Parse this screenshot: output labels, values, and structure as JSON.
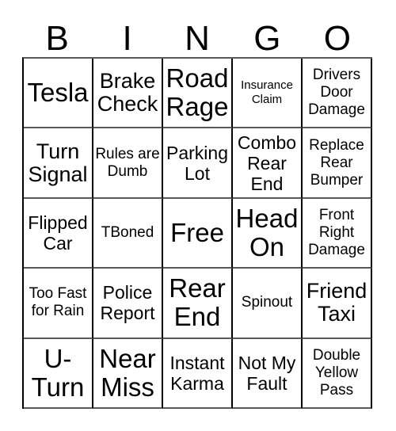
{
  "card": {
    "columns": [
      "B",
      "I",
      "N",
      "G",
      "O"
    ],
    "rows": [
      [
        {
          "text": "Tesla",
          "size": "fs-xl"
        },
        {
          "text": "Brake Check",
          "size": "fs-lg"
        },
        {
          "text": "Road Rage",
          "size": "fs-xl"
        },
        {
          "text": "Insurance Claim",
          "size": "fs-xs"
        },
        {
          "text": "Drivers Door Damage",
          "size": "fs-sm"
        }
      ],
      [
        {
          "text": "Turn Signal",
          "size": "fs-lg"
        },
        {
          "text": "Rules are Dumb",
          "size": "fs-sm"
        },
        {
          "text": "Parking Lot",
          "size": "fs-md"
        },
        {
          "text": "Combo Rear End",
          "size": "fs-md"
        },
        {
          "text": "Replace Rear Bumper",
          "size": "fs-sm"
        }
      ],
      [
        {
          "text": "Flipped Car",
          "size": "fs-md"
        },
        {
          "text": "TBoned",
          "size": "fs-sm"
        },
        {
          "text": "Free",
          "size": "fs-xl"
        },
        {
          "text": "Head On",
          "size": "fs-xl"
        },
        {
          "text": "Front Right Damage",
          "size": "fs-sm"
        }
      ],
      [
        {
          "text": "Too Fast for Rain",
          "size": "fs-sm"
        },
        {
          "text": "Police Report",
          "size": "fs-md"
        },
        {
          "text": "Rear End",
          "size": "fs-xl"
        },
        {
          "text": "Spinout",
          "size": "fs-sm"
        },
        {
          "text": "Friend Taxi",
          "size": "fs-lg"
        }
      ],
      [
        {
          "text": "U-Turn",
          "size": "fs-xl"
        },
        {
          "text": "Near Miss",
          "size": "fs-xl"
        },
        {
          "text": "Instant Karma",
          "size": "fs-md"
        },
        {
          "text": "Not My Fault",
          "size": "fs-md"
        },
        {
          "text": "Double Yellow Pass",
          "size": "fs-sm"
        }
      ]
    ]
  },
  "colors": {
    "background": "#ffffff",
    "text": "#000000",
    "grid_line": "#000000"
  }
}
